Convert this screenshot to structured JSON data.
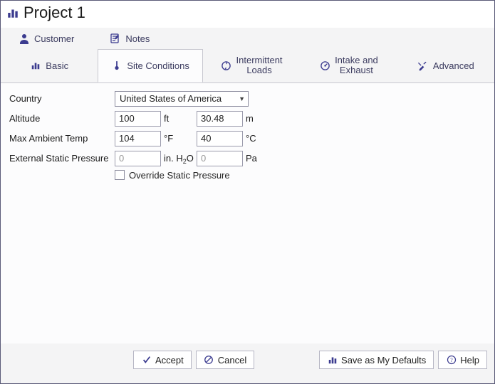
{
  "colors": {
    "accent": "#3b3b8f"
  },
  "header": {
    "title": "Project 1"
  },
  "topTabs": {
    "customer": "Customer",
    "notes": "Notes"
  },
  "mainTabs": {
    "basic": "Basic",
    "siteConditions": "Site Conditions",
    "intermittent1": "Intermittent",
    "intermittent2": "Loads",
    "intake1": "Intake and",
    "intake2": "Exhaust",
    "advanced": "Advanced"
  },
  "form": {
    "country": {
      "label": "Country",
      "value": "United States of America"
    },
    "altitude": {
      "label": "Altitude",
      "val1": "100",
      "unit1": "ft",
      "val2": "30.48",
      "unit2": "m"
    },
    "maxAmbient": {
      "label": "Max Ambient Temp",
      "val1": "104",
      "unit1": "°F",
      "val2": "40",
      "unit2": "°C"
    },
    "extStatic": {
      "label": "External Static Pressure",
      "val1": "0",
      "unit1_pre": "in. H",
      "unit1_sub": "2",
      "unit1_post": "O",
      "val2": "0",
      "unit2": "Pa"
    },
    "override": {
      "label": "Override Static Pressure"
    }
  },
  "footer": {
    "accept": "Accept",
    "cancel": "Cancel",
    "saveDefaults": "Save as My Defaults",
    "help": "Help"
  }
}
